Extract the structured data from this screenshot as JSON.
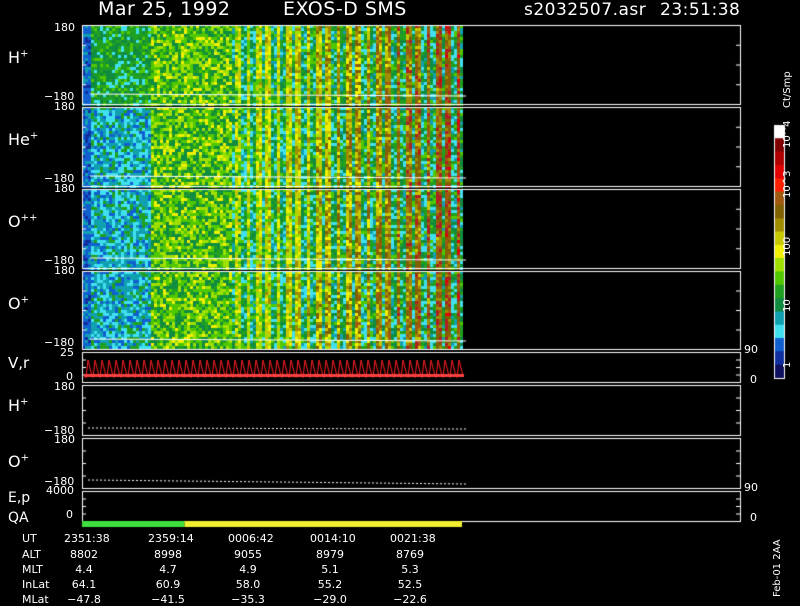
{
  "header": {
    "date": "Mar 25, 1992",
    "instrument": "EXOS-D SMS",
    "file": "s2032507.asr",
    "time": "23:51:38"
  },
  "colorbar": {
    "unit_label": "Ct/Smp",
    "ticks": [
      "10^4",
      "10^3",
      "100",
      "10",
      "1"
    ],
    "colors": [
      "#ffffff",
      "#800000",
      "#b00000",
      "#e00000",
      "#ff2000",
      "#a05a10",
      "#806000",
      "#a08c00",
      "#c8c800",
      "#f0f000",
      "#a0e000",
      "#50c800",
      "#20a020",
      "#108c40",
      "#10a0b0",
      "#40e0f0",
      "#1060d0",
      "#1030a0",
      "#101060"
    ]
  },
  "panels": [
    {
      "label": "H",
      "sup": "+",
      "ymax": "180",
      "ymin": "−180"
    },
    {
      "label": "He",
      "sup": "+",
      "ymax": "180",
      "ymin": "−180"
    },
    {
      "label": "O",
      "sup": "++",
      "ymax": "180",
      "ymin": "−180"
    },
    {
      "label": "O",
      "sup": "+",
      "ymax": "180",
      "ymin": "−180"
    },
    {
      "label": "V,r",
      "sup": "",
      "ymax": "25",
      "ymin": "0",
      "right_max": "90",
      "right_min": "0"
    },
    {
      "label": "H",
      "sup": "+",
      "ymax": "180",
      "ymin": "−180"
    },
    {
      "label": "O",
      "sup": "+",
      "ymax": "180",
      "ymin": "−180"
    },
    {
      "label": "E,p",
      "sup": "",
      "ymax": "4000",
      "ymin": "0",
      "right_max": "90",
      "right_min": "0"
    }
  ],
  "qa": {
    "label": "QA",
    "segments": [
      {
        "color": "#40e040",
        "fraction": 0.27
      },
      {
        "color": "#f0f030",
        "fraction": 0.73
      }
    ]
  },
  "ephemeris": {
    "labels": [
      "UT",
      "ALT",
      "MLT",
      "InLat",
      "MLat"
    ],
    "rows": [
      [
        "2351:38",
        "2359:14",
        "0006:42",
        "0014:10",
        "0021:38"
      ],
      [
        "8802",
        "8998",
        "9055",
        "8979",
        "8769"
      ],
      [
        "4.4",
        "4.7",
        "4.9",
        "5.1",
        "5.3"
      ],
      [
        "64.1",
        "60.9",
        "58.0",
        "55.2",
        "52.5"
      ],
      [
        "−47.8",
        "−41.5",
        "−35.3",
        "−29.0",
        "−22.6"
      ]
    ]
  },
  "footer": {
    "stamp": "Feb-01 2AA"
  },
  "chart_data": {
    "type": "heatmap",
    "title": "Mar 25, 1992   EXOS-D SMS",
    "x": [
      "2351:38",
      "2359:14",
      "0006:42",
      "0014:10",
      "0021:38"
    ],
    "series": [
      {
        "name": "H+",
        "ylim": [
          -180,
          180
        ]
      },
      {
        "name": "He+",
        "ylim": [
          -180,
          180
        ]
      },
      {
        "name": "O++",
        "ylim": [
          -180,
          180
        ]
      },
      {
        "name": "O+",
        "ylim": [
          -180,
          180
        ]
      }
    ],
    "color_scale": {
      "label": "Ct/Smp",
      "log": true,
      "range": [
        1,
        10000
      ]
    },
    "grid": false
  }
}
